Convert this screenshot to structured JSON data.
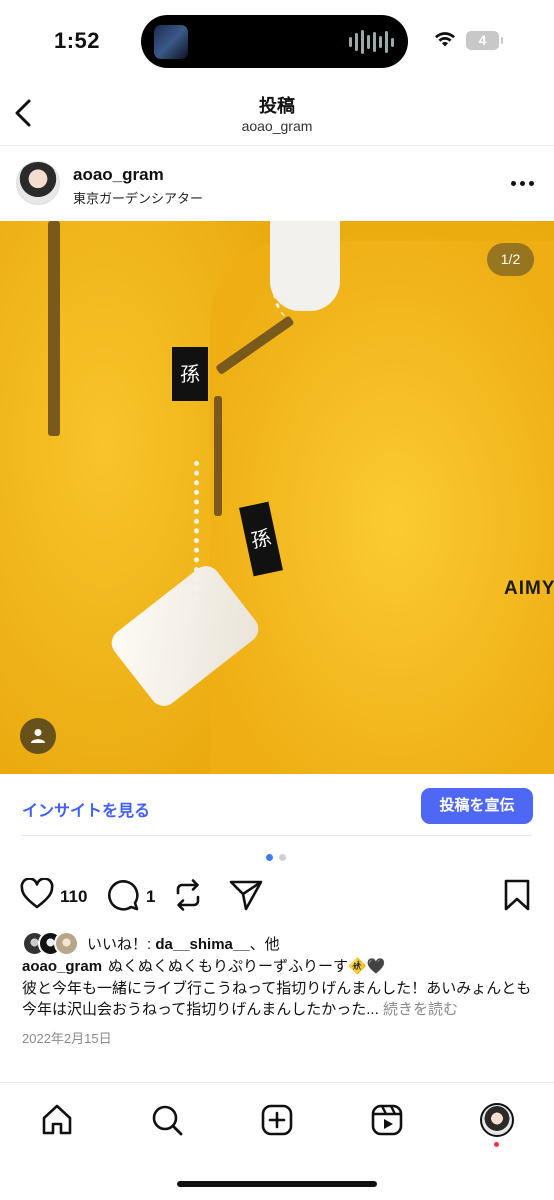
{
  "status_bar": {
    "time": "1:52",
    "battery": "4",
    "icons": [
      "wifi-icon",
      "battery-icon",
      "audio-wave-icon"
    ]
  },
  "header": {
    "title": "投稿",
    "subtitle": "aoao_gram",
    "back_icon": "chevron-left-icon"
  },
  "post": {
    "username": "aoao_gram",
    "location": "東京ガーデンシアター",
    "image_counter": "1/2",
    "image_text": {
      "patch_1": "孫",
      "patch_2": "孫",
      "brand": "AIMY"
    }
  },
  "insight": {
    "link_label": "インサイトを見る",
    "promote_label": "投稿を宣伝"
  },
  "carousel": {
    "count": 2,
    "active": 0,
    "active_color": "#3f7bf5"
  },
  "actions": {
    "like_count": "110",
    "comment_count": "1"
  },
  "likes": {
    "prefix": "いいね！: ",
    "user": "da__shima__",
    "suffix": "、他"
  },
  "caption": {
    "user": "aoao_gram",
    "line1": "ぬくぬくぬくもりぷりーずふりーす",
    "emoji": "🚸🖤",
    "body": "彼と今年も一緒にライブ行こうねって指切りげんまんした！あいみょんとも今年は沢山会おうねって指切りげんまんしたかった...",
    "more": "続きを読む"
  },
  "date": "2022年2月15日",
  "nav": {
    "items": [
      "home-icon",
      "search-icon",
      "create-icon",
      "reels-icon",
      "profile-avatar"
    ]
  },
  "colors": {
    "accent": "#4e68f5",
    "link": "#3f5efb",
    "fleece": "#f5bd1c",
    "notification": "#ff3040"
  }
}
